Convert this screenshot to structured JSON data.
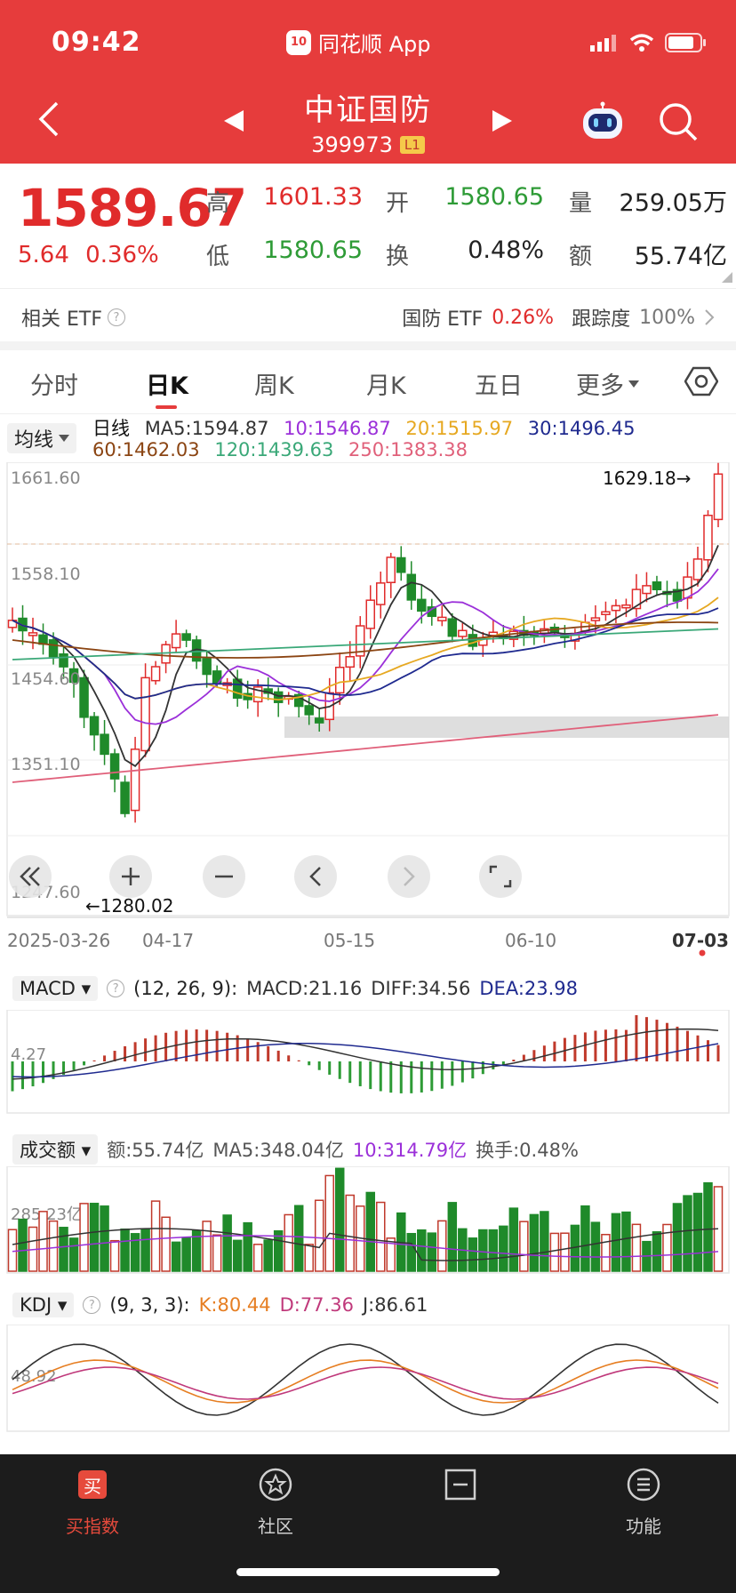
{
  "status": {
    "time": "09:42",
    "app_name": "同花顺 App",
    "app_logo_text": "10"
  },
  "header": {
    "name": "中证国防",
    "code": "399973",
    "level": "L1"
  },
  "quote": {
    "last_price": "1589.67",
    "change": "5.64",
    "change_pct": "0.36%",
    "high_label": "高",
    "high": "1601.33",
    "open_label": "开",
    "open": "1580.65",
    "volume_label": "量",
    "volume": "259.05万",
    "low_label": "低",
    "low": "1580.65",
    "turnover_label": "换",
    "turnover": "0.48%",
    "amount_label": "额",
    "amount": "55.74亿"
  },
  "etf": {
    "label": "相关 ETF",
    "name": "国防 ETF",
    "pct": "0.26%",
    "tracking_label": "跟踪度",
    "tracking": "100%"
  },
  "tabs": [
    "分时",
    "日K",
    "周K",
    "月K",
    "五日",
    "更多"
  ],
  "active_tab": "日K",
  "ma": {
    "select": "均线",
    "title": "日线",
    "ma5": "MA5:1594.87",
    "ma10": "10:1546.87",
    "ma20": "20:1515.97",
    "ma30": "30:1496.45",
    "ma60": "60:1462.03",
    "ma120": "120:1439.63",
    "ma250": "250:1383.38",
    "colors": {
      "ma5": "#333333",
      "ma10": "#9b30d9",
      "ma20": "#e6a821",
      "ma30": "#1f2a8f",
      "ma60": "#8b4513",
      "ma120": "#3aa878",
      "ma250": "#e0607a"
    }
  },
  "kline": {
    "y_labels": [
      "1661.60",
      "1558.10",
      "1454.60",
      "1351.10",
      "1247.60"
    ],
    "max_marker": "1629.18→",
    "min_marker": "←1280.02",
    "dates": [
      "2025-03-26",
      "04-17",
      "05-15",
      "06-10",
      "07-03"
    ],
    "control_icons": [
      "double-left-icon",
      "zoom-in-icon",
      "zoom-out-icon",
      "step-left-icon",
      "step-right-icon",
      "fullscreen-icon"
    ]
  },
  "macd": {
    "select": "MACD",
    "params": "(12, 26, 9):",
    "macd": "MACD:21.16",
    "diff": "DIFF:34.56",
    "dea": "DEA:23.98",
    "y_label": "4.27"
  },
  "amount_chart": {
    "select": "成交额",
    "amount": "额:55.74亿",
    "ma5": "MA5:348.04亿",
    "ma10": "10:314.79亿",
    "turnover": "换手:0.48%",
    "y_label": "285.23亿"
  },
  "kdj": {
    "select": "KDJ",
    "params": "(9, 3, 3):",
    "k": "K:80.44",
    "d": "D:77.36",
    "j": "J:86.61",
    "y_label": "48.92"
  },
  "bottom_nav": [
    {
      "label": "买指数",
      "icon": "buy-icon",
      "glyph": "买"
    },
    {
      "label": "社区",
      "icon": "community-icon"
    },
    {
      "label": "",
      "icon": "minus-box-icon"
    },
    {
      "label": "功能",
      "icon": "menu-icon"
    }
  ]
}
